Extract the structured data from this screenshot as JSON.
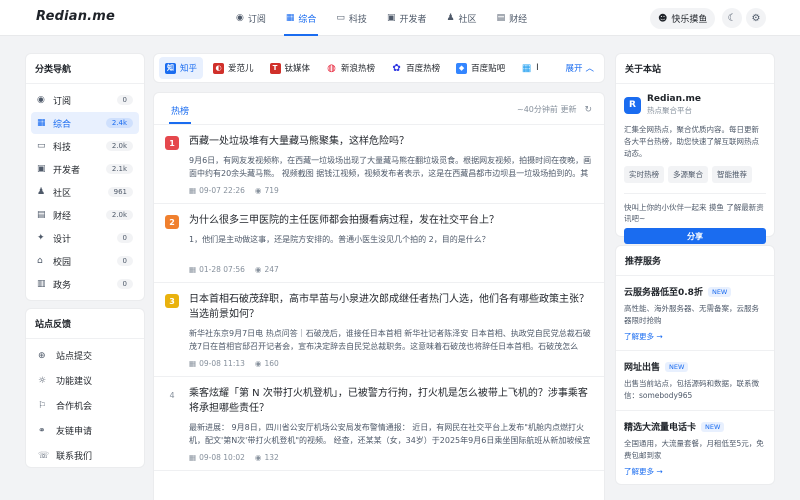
{
  "header": {
    "logo": "Redian.me",
    "nav": [
      {
        "label": "订阅",
        "icon": "rss-icon",
        "glyph": "◉",
        "active": false
      },
      {
        "label": "综合",
        "icon": "grid-icon",
        "glyph": "▦",
        "active": true
      },
      {
        "label": "科技",
        "icon": "monitor-icon",
        "glyph": "▭",
        "active": false
      },
      {
        "label": "开发者",
        "icon": "terminal-icon",
        "glyph": "▣",
        "active": false
      },
      {
        "label": "社区",
        "icon": "users-icon",
        "glyph": "♟",
        "active": false
      },
      {
        "label": "财经",
        "icon": "wallet-icon",
        "glyph": "▤",
        "active": false
      }
    ],
    "moyu_label": "快乐摸鱼"
  },
  "sidebar": {
    "title": "分类导航",
    "items": [
      {
        "label": "订阅",
        "count": "0",
        "icon": "rss-icon",
        "glyph": "◉"
      },
      {
        "label": "综合",
        "count": "2.4k",
        "icon": "grid-icon",
        "glyph": "▦",
        "active": true
      },
      {
        "label": "科技",
        "count": "2.0k",
        "icon": "monitor-icon",
        "glyph": "▭"
      },
      {
        "label": "开发者",
        "count": "2.1k",
        "icon": "terminal-icon",
        "glyph": "▣"
      },
      {
        "label": "社区",
        "count": "961",
        "icon": "users-icon",
        "glyph": "♟"
      },
      {
        "label": "财经",
        "count": "2.0k",
        "icon": "wallet-icon",
        "glyph": "▤"
      },
      {
        "label": "设计",
        "count": "0",
        "icon": "design-icon",
        "glyph": "✦"
      },
      {
        "label": "校园",
        "count": "0",
        "icon": "school-icon",
        "glyph": "⌂"
      },
      {
        "label": "政务",
        "count": "0",
        "icon": "government-icon",
        "glyph": "▥"
      }
    ]
  },
  "feedback": {
    "title": "站点反馈",
    "items": [
      {
        "label": "站点提交",
        "icon": "globe-icon",
        "glyph": "⊕"
      },
      {
        "label": "功能建议",
        "icon": "lightbulb-icon",
        "glyph": "☼"
      },
      {
        "label": "合作机会",
        "icon": "handshake-icon",
        "glyph": "⚐"
      },
      {
        "label": "友链申请",
        "icon": "link-icon",
        "glyph": "⚭"
      },
      {
        "label": "联系我们",
        "icon": "contact-icon",
        "glyph": "☏"
      }
    ]
  },
  "sources": {
    "tabs": [
      {
        "label": "知乎",
        "icon": "zhihu-icon",
        "glyph": "知",
        "color": "#1a6cf0",
        "active": true
      },
      {
        "label": "爱范儿",
        "icon": "ifanr-icon",
        "glyph": "◐",
        "color": "#d0302a"
      },
      {
        "label": "钛媒体",
        "icon": "tmtpost-icon",
        "glyph": "T",
        "color": "#d0302a"
      },
      {
        "label": "新浪热榜",
        "icon": "sina-icon",
        "glyph": "◍",
        "color": "#e6162d"
      },
      {
        "label": "百度热榜",
        "icon": "baidu-icon",
        "glyph": "✿",
        "color": "#2932e1"
      },
      {
        "label": "百度贴吧",
        "icon": "tieba-icon",
        "glyph": "◆",
        "color": "#3385ff"
      },
      {
        "label": "I",
        "icon": "calendar-icon",
        "glyph": "▦",
        "color": "#1a9cf0"
      }
    ],
    "expand_label": "展开"
  },
  "list": {
    "tab": "热榜",
    "update_text": "~40分钟前 更新",
    "items": [
      {
        "rank": "1",
        "rank_color": "#e5484d",
        "title": "西藏一处垃圾堆有大量藏马熊聚集，这样危险吗？",
        "desc": "9月6日，有网友发视频称，在西藏一垃圾场出现了大量藏马熊在翻垃圾觅食。根据网友视频，拍摄时间在夜晚，画面中约有20余头藏马熊。 视频截图 据钱江视频，视频发布者表示，这是在西藏昌都市边坝县一垃圾场拍到的。其称这是自己第一次看到这种情况，当时坐在车上紧握方向盘随时准备撤退。昌都市林…",
        "date": "09-07 22:26",
        "views": "719"
      },
      {
        "rank": "2",
        "rank_color": "#f0802e",
        "title": "为什么很多三甲医院的主任医师都会拍摄看病过程，发在社交平台上？",
        "desc": "1，他们是主动做这事，还是院方安排的。普通小医生没见几个拍的 2，目的是什么？",
        "date": "01-28 07:56",
        "views": "247"
      },
      {
        "rank": "3",
        "rank_color": "#e9b20e",
        "title": "日本首相石破茂辞职，高市早苗与小泉进次郎成继任者热门人选，他们各有哪些政策主张？当选前景如何？",
        "desc": "新华社东京9月7日电 热点问答｜石破茂后，谁接任日本首相 新华社记者陈泽安 日本首相、执政党自民党总裁石破茂7日在首相官邸召开记者会，宣布决定辞去自民党总裁职务。这意味着石破茂也将辞任日本首相。石破茂怎么说？新任自民党总裁将面对哪些难题？谁有可能成为下任首相？ 石破茂怎么说 石破茂在…",
        "date": "09-08 11:13",
        "views": "160"
      },
      {
        "rank": "4",
        "rank_color": "",
        "title": "乘客炫耀「第 N 次带打火机登机」，已被警方行拘，打火机是怎么被带上飞机的？涉事乘客将承担哪些责任？",
        "desc": "最新进展： 9月8日，四川省公安厅机场公安局发布警情通报： 近日，有网民在社交平台上发布\"机舱内点燃打火机，配文'第N次'带打火机登机\"的视频。 经查，还某某（女，34岁）于2025年9月6日乘坐国际航班从新加坡候宜机场飞往成都天府国际机场。航班飞行过程中，还某某为博取流量，吸引关注，在座位上点…",
        "date": "09-08 10:02",
        "views": "132"
      }
    ]
  },
  "about": {
    "title": "关于本站",
    "name": "Redian.me",
    "subtitle": "热点聚合平台",
    "desc": "汇集全网热点，聚合优质内容。每日更新各大平台热榜，助您快速了解互联网热点动态。",
    "tags": [
      "实时热榜",
      "多源聚合",
      "智能推荐"
    ],
    "share_text": "快叫上你的小伙伴一起来 摸鱼 了解最新资讯吧~",
    "share_button": "分享"
  },
  "services": {
    "title": "推荐服务",
    "items": [
      {
        "title": "云服务器低至0.8折",
        "badge": "NEW",
        "desc": "高性能、海外服务器、无需备案，云服务器限时抢购",
        "link": "了解更多 →"
      },
      {
        "title": "网址出售",
        "badge": "NEW",
        "desc": "出售当前站点，包括源码和数据，联系微信：somebody965",
        "link": ""
      },
      {
        "title": "精选大流量电话卡",
        "badge": "NEW",
        "desc": "全国通用，大流量套餐，月租低至5元，免费包邮到家",
        "link": "了解更多 →"
      }
    ]
  }
}
